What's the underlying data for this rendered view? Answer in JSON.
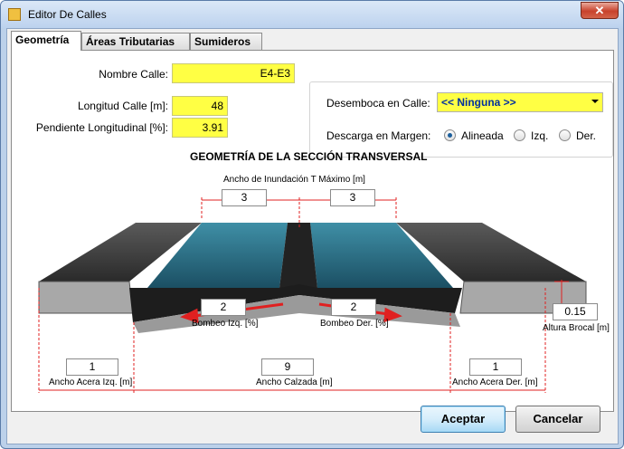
{
  "window": {
    "title": "Editor De Calles",
    "close_glyph": "✕"
  },
  "tabs": [
    {
      "label": "Geometría",
      "active": true
    },
    {
      "label": "Áreas Tributarias",
      "active": false
    },
    {
      "label": "Sumideros",
      "active": false
    }
  ],
  "form": {
    "nombre_calle": {
      "label": "Nombre Calle:",
      "value": "E4-E3"
    },
    "longitud_calle": {
      "label": "Longitud Calle [m]:",
      "value": "48"
    },
    "pendiente": {
      "label": "Pendiente Longitudinal [%]:",
      "value": "3.91"
    }
  },
  "desemboca": {
    "label": "Desemboca en Calle:",
    "value": "<< Ninguna >>"
  },
  "descarga": {
    "label": "Descarga en Margen:",
    "options": [
      "Alineada",
      "Izq.",
      "Der."
    ],
    "selected": "Alineada"
  },
  "section": {
    "title": "GEOMETRÍA DE LA SECCIÓN TRANSVERSAL",
    "ancho_inundacion_label": "Ancho de Inundación T Máximo [m]",
    "t_izq": "3",
    "t_der": "3",
    "bombeo_izq_label": "Bombeo Izq. [%]",
    "bombeo_izq": "2",
    "bombeo_der_label": "Bombeo Der. [%]",
    "bombeo_der": "2",
    "altura_brocal_label": "Altura Brocal [m]",
    "altura_brocal": "0.15",
    "acera_izq_label": "Ancho Acera Izq. [m]",
    "acera_izq": "1",
    "calzada_label": "Ancho Calzada [m]",
    "calzada": "9",
    "acera_der_label": "Ancho Acera Der. [m]",
    "acera_der": "1"
  },
  "buttons": {
    "accept": "Aceptar",
    "cancel": "Cancelar"
  },
  "colors": {
    "highlight": "#FFFF44",
    "combo_text": "#0030A0",
    "dimension_line": "#E02020"
  }
}
